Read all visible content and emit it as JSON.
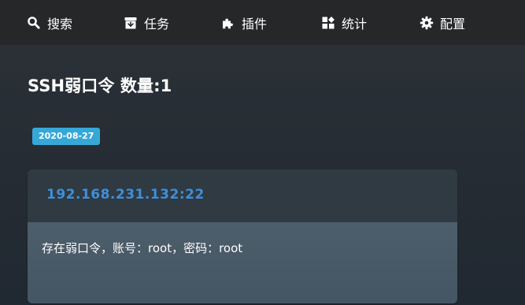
{
  "nav": {
    "items": [
      {
        "label": "搜索",
        "icon": "search-icon"
      },
      {
        "label": "任务",
        "icon": "archive-icon"
      },
      {
        "label": "插件",
        "icon": "puzzle-icon"
      },
      {
        "label": "统计",
        "icon": "dashboard-icon"
      },
      {
        "label": "配置",
        "icon": "gear-icon"
      }
    ]
  },
  "page": {
    "title": "SSH弱口令 数量:1"
  },
  "results": [
    {
      "date": "2020-08-27",
      "host": "192.168.231.132:22",
      "description": "存在弱口令，账号：root，密码：root"
    }
  ],
  "colors": {
    "nav_bg": "#262729",
    "badge": "#36a8d8",
    "host_link": "#3f8fd8",
    "card_header": "#2f3a43",
    "card_body": "#4a5a67"
  }
}
